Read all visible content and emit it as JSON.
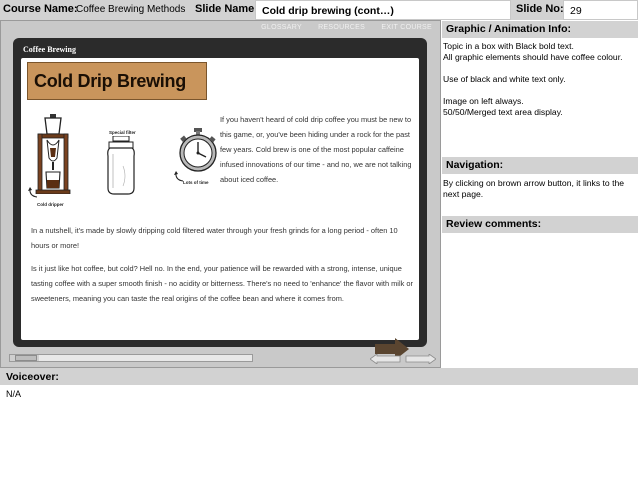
{
  "header": {
    "course_name_label": "Course Name:",
    "course_name": "Coffee Brewing Methods",
    "slide_name_label": "Slide Name:",
    "slide_name": "Cold drip brewing (cont…)",
    "slide_no_label": "Slide No:",
    "slide_no": "29"
  },
  "player": {
    "nav": [
      "GLOSSARY",
      "RESOURCES",
      "EXIT COURSE"
    ],
    "screen_title": "Coffee Brewing",
    "slide_heading": "Cold Drip Brewing",
    "captions": {
      "dripper": "Cold dripper",
      "filter": "Special filter",
      "time": "Lots of time"
    },
    "paragraph1": "If you haven't heard of cold drip coffee you must be new to this game, or, you've been hiding under a rock for the past few years. Cold brew is one of the most popular caffeine infused innovations of our time - and no, we are not talking about iced coffee.",
    "paragraph2": "In a nutshell, it's made by slowly dripping cold filtered water through your fresh grinds for a long period - often 10 hours or more!",
    "paragraph3": "Is it just like hot coffee, but cold? Hell no. In the end, your patience will be rewarded with a strong, intense, unique tasting coffee with a super smooth finish - no acidity or bitterness. There's no need to 'enhance' the flavor with milk or sweeteners, meaning you can taste the real origins of the coffee bean and where it comes from.",
    "progress": 0.12
  },
  "side": {
    "graphic_head": "Graphic / Animation Info:",
    "graphic_lines": [
      "Topic in a box with Black bold text.",
      "All graphic elements should have coffee colour.",
      "Use of black and white text only.",
      "Image on left always.",
      "50/50/Merged text area display."
    ],
    "navigation_head": "Navigation:",
    "navigation_text": "By clicking on brown arrow button, it links to the next page.",
    "review_head": "Review comments:"
  },
  "voiceover": {
    "head": "Voiceover:",
    "text": "N/A"
  },
  "colors": {
    "accent_brown": "#c9955c",
    "arrow_brown": "#5a4530",
    "bar_grey": "#d2d2d2"
  }
}
